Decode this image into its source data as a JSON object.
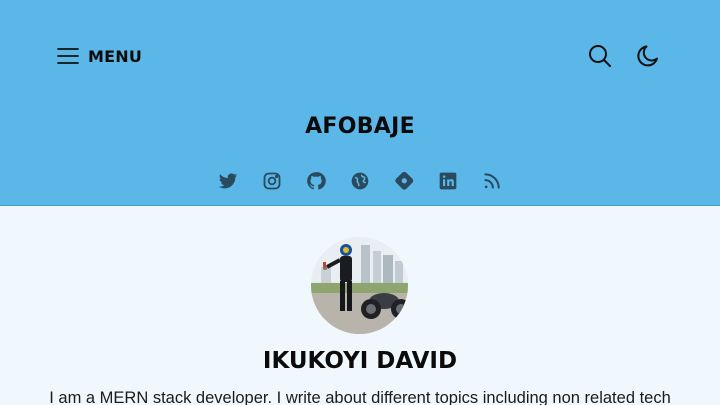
{
  "header": {
    "menu_label": "MENU",
    "site_title": "AFOBAJE",
    "background_color": "#5ab7e8",
    "menu_icon": "hamburger-menu-icon",
    "search_icon": "search-icon",
    "theme_icon": "moon-icon"
  },
  "social_links": [
    {
      "icon": "twitter-icon"
    },
    {
      "icon": "instagram-icon"
    },
    {
      "icon": "github-icon"
    },
    {
      "icon": "globe-icon"
    },
    {
      "icon": "hashnode-icon"
    },
    {
      "icon": "linkedin-icon"
    },
    {
      "icon": "rss-icon"
    }
  ],
  "profile": {
    "name": "IKUKOYI DAVID",
    "bio": "I am a MERN stack developer. I write about different topics including non related tech",
    "avatar_icon": "profile-avatar"
  },
  "page_background": "#f0f8fe"
}
